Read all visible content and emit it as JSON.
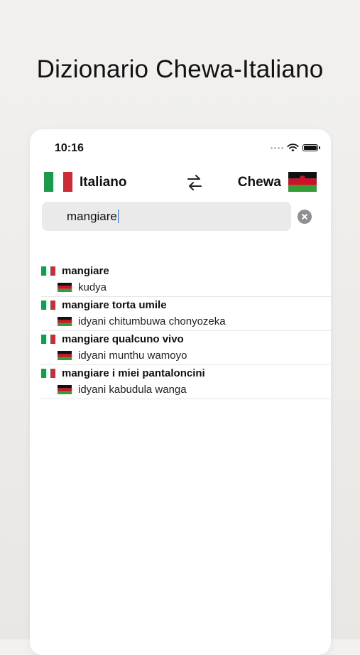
{
  "headline": "Dizionario Chewa-Italiano",
  "status_bar": {
    "time": "10:16"
  },
  "language_bar": {
    "source_language": "Italiano",
    "target_language": "Chewa",
    "source_flag": "italy-flag",
    "target_flag": "malawi-flag",
    "swap_icon": "swap-arrows-icon"
  },
  "search": {
    "value": "mangiare",
    "clear_icon": "clear-circle-icon"
  },
  "results": [
    {
      "term": "mangiare",
      "translation": "kudya"
    },
    {
      "term": "mangiare torta umile",
      "translation": "idyani chitumbuwa chonyozeka"
    },
    {
      "term": "mangiare qualcuno vivo",
      "translation": "idyani munthu wamoyo"
    },
    {
      "term": "mangiare i miei pantaloncini",
      "translation": "idyani kabudula wanga"
    }
  ],
  "colors": {
    "italy_green": "#1a9a4a",
    "italy_red": "#ce2b37",
    "malawi_black": "#111111",
    "malawi_red": "#ce1126",
    "malawi_green": "#339e35"
  }
}
